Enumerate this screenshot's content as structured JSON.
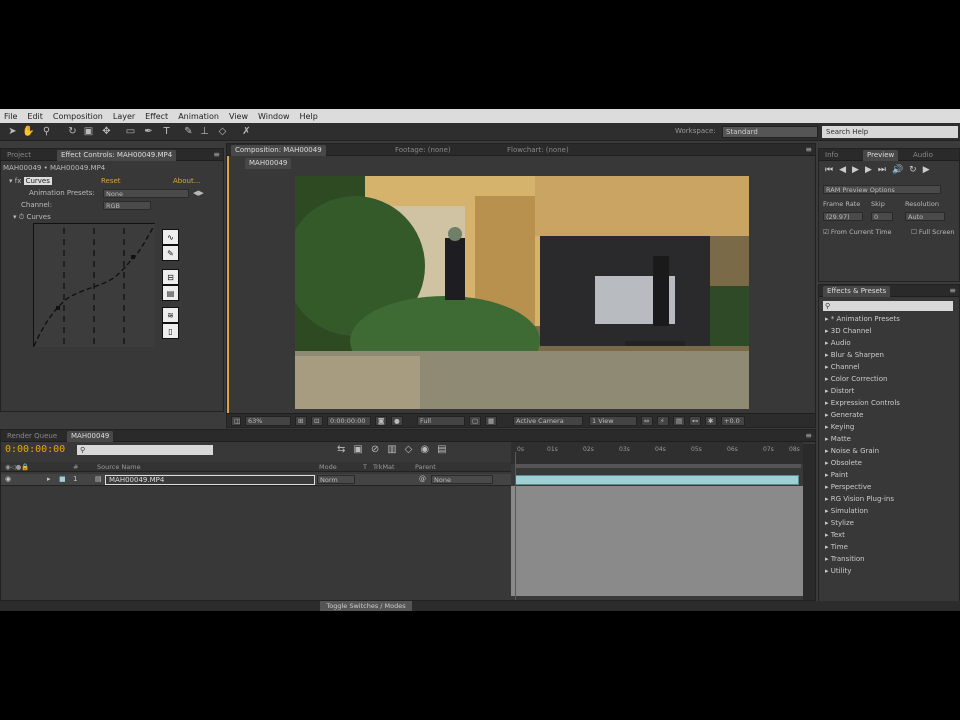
{
  "menu": {
    "items": [
      "File",
      "Edit",
      "Composition",
      "Layer",
      "Effect",
      "Animation",
      "View",
      "Window",
      "Help"
    ]
  },
  "toolbar": {
    "workspace_label": "Workspace:",
    "workspace_value": "Standard",
    "search_placeholder": "Search Help"
  },
  "effect_controls": {
    "tabs": [
      "Project",
      "Effect Controls: MAH00049.MP4"
    ],
    "layer_path": "MAH00049 • MAH00049.MP4",
    "effect_name": "Curves",
    "reset_label": "Reset",
    "about_label": "About...",
    "animation_presets_label": "Animation Presets:",
    "animation_presets_value": "None",
    "channel_label": "Channel:",
    "channel_value": "RGB",
    "curves_label": "Curves"
  },
  "composition": {
    "tabs": [
      "Composition: MAH00049",
      "Footage: (none)",
      "Flowchart: (none)"
    ],
    "breadcrumb": "MAH00049",
    "zoom": "63%",
    "timecode": "0:00:00:00",
    "resolution": "Full",
    "camera": "Active Camera",
    "views": "1 View",
    "exposure": "+0.0"
  },
  "preview": {
    "tabs": [
      "Info",
      "Preview",
      "Audio"
    ],
    "ram_preview": "RAM Preview Options",
    "frame_rate_label": "Frame Rate",
    "skip_label": "Skip",
    "resolution_label": "Resolution",
    "frame_rate_value": "(29.97)",
    "skip_value": "0",
    "resolution_value": "Auto",
    "from_current": "From Current Time",
    "full_screen": "Full Screen"
  },
  "effects_presets": {
    "tab": "Effects & Presets",
    "search": "",
    "items": [
      "* Animation Presets",
      "3D Channel",
      "Audio",
      "Blur & Sharpen",
      "Channel",
      "Color Correction",
      "Distort",
      "Expression Controls",
      "Generate",
      "Keying",
      "Matte",
      "Noise & Grain",
      "Obsolete",
      "Paint",
      "Perspective",
      "RG Vision Plug-ins",
      "Simulation",
      "Stylize",
      "Text",
      "Time",
      "Transition",
      "Utility"
    ]
  },
  "timeline": {
    "tabs": [
      "Render Queue",
      "MAH00049"
    ],
    "timecode": "0:00:00:00",
    "search_placeholder": "",
    "columns": [
      "#",
      "Source Name",
      "Mode",
      "T",
      "TrkMat",
      "Parent"
    ],
    "layer": {
      "index": "1",
      "name": "MAH00049.MP4",
      "mode": "Norm",
      "parent": "None"
    },
    "ruler_ticks": [
      "0s",
      "01s",
      "02s",
      "03s",
      "04s",
      "05s",
      "06s",
      "07s",
      "08s"
    ],
    "toggle_label": "Toggle Switches / Modes"
  },
  "colors": {
    "accent": "#d9a441",
    "timecode": "#e6a800",
    "layer_bar": "#9ed0d4",
    "playhead": "#e02020"
  }
}
